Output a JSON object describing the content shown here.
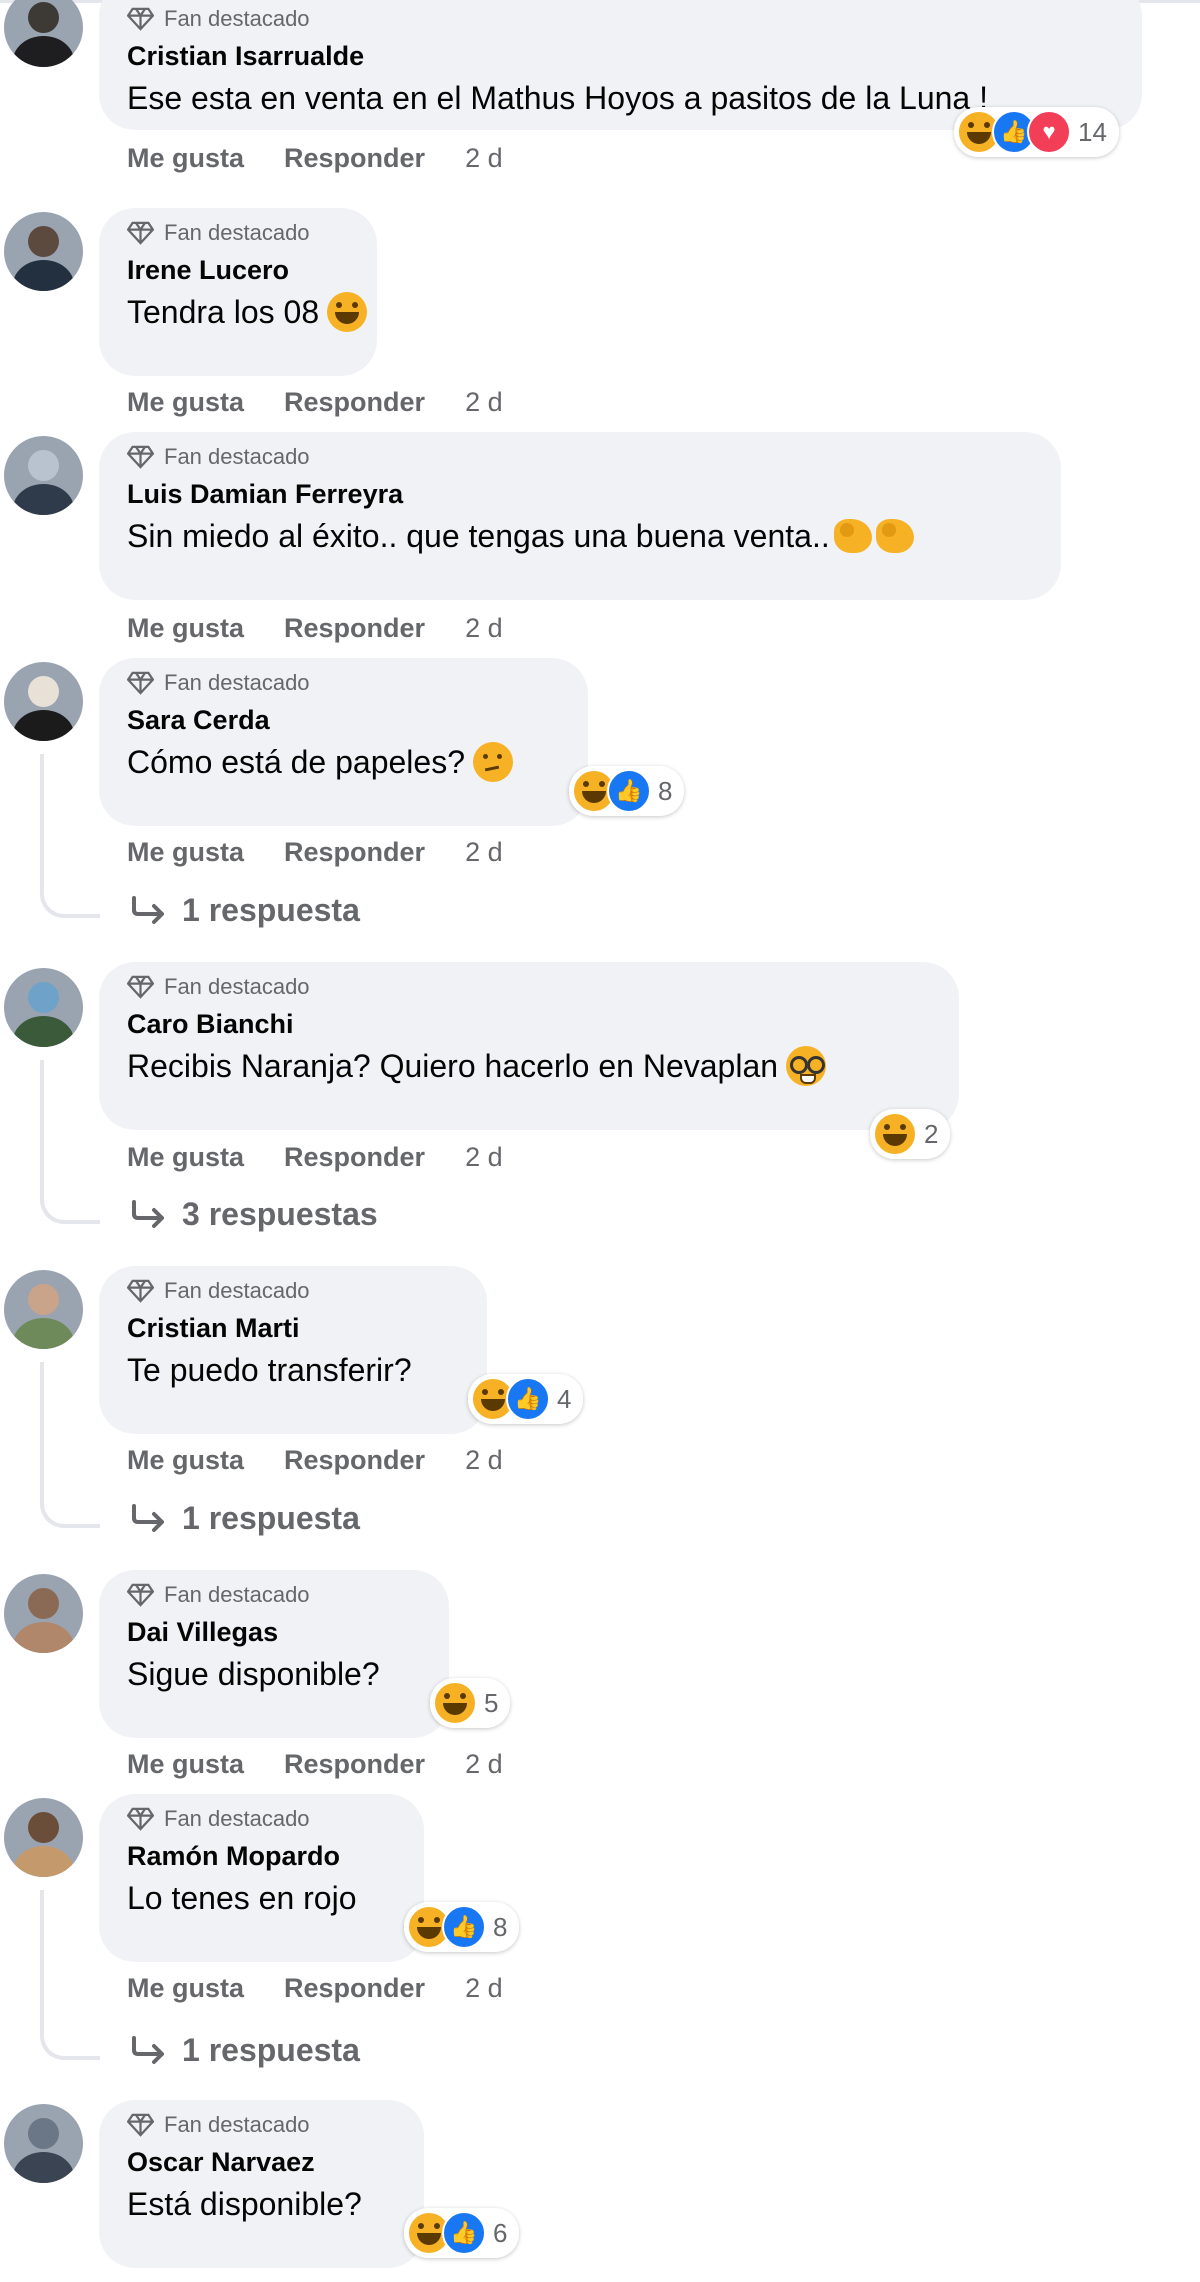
{
  "comments": [
    {
      "badge": "Fan destacado",
      "name": "Cristian Isarrualde",
      "text": "Ese esta en venta en el Mathus Hoyos a pasitos de la Luna !",
      "like": "Me gusta",
      "reply": "Responder",
      "time": "2 d",
      "reactions": {
        "icons": [
          "haha",
          "like",
          "love"
        ],
        "count": "14"
      },
      "avatar_colors": [
        "#3d3a36",
        "#1e1e20"
      ]
    },
    {
      "badge": "Fan destacado",
      "name": "Irene Lucero",
      "text": "Tendra los 08",
      "text_emoji": "haha",
      "like": "Me gusta",
      "reply": "Responder",
      "time": "2 d",
      "avatar_colors": [
        "#5d4a3f",
        "#233040"
      ]
    },
    {
      "badge": "Fan destacado",
      "name": "Luis Damian Ferreyra",
      "text": "Sin miedo al éxito.. que tengas una buena venta..",
      "text_emoji": "flexed-biceps-x2",
      "like": "Me gusta",
      "reply": "Responder",
      "time": "2 d",
      "avatar_colors": [
        "#b9c3cf",
        "#2f3b4b"
      ]
    },
    {
      "badge": "Fan destacado",
      "name": "Sara Cerda",
      "text": "Cómo está de papeles?",
      "text_emoji": "thinking",
      "like": "Me gusta",
      "reply": "Responder",
      "time": "2 d",
      "reactions": {
        "icons": [
          "haha",
          "like"
        ],
        "count": "8"
      },
      "replies": "1 respuesta",
      "avatar_colors": [
        "#e8e1d8",
        "#1b1b1b"
      ]
    },
    {
      "badge": "Fan destacado",
      "name": "Caro Bianchi",
      "text": "Recibis Naranja? Quiero hacerlo en Nevaplan",
      "text_emoji": "nerd",
      "like": "Me gusta",
      "reply": "Responder",
      "time": "2 d",
      "reactions": {
        "icons": [
          "haha"
        ],
        "count": "2"
      },
      "replies": "3 respuestas",
      "avatar_colors": [
        "#6fa2c9",
        "#3a5a3a"
      ]
    },
    {
      "badge": "Fan destacado",
      "name": "Cristian Marti",
      "text": "Te puedo transferir?",
      "like": "Me gusta",
      "reply": "Responder",
      "time": "2 d",
      "reactions": {
        "icons": [
          "haha",
          "like"
        ],
        "count": "4"
      },
      "replies": "1 respuesta",
      "avatar_colors": [
        "#c9a48a",
        "#6f8a5a"
      ]
    },
    {
      "badge": "Fan destacado",
      "name": "Dai Villegas",
      "text": "Sigue disponible?",
      "like": "Me gusta",
      "reply": "Responder",
      "time": "2 d",
      "reactions": {
        "icons": [
          "haha"
        ],
        "count": "5"
      },
      "avatar_colors": [
        "#8a6a55",
        "#b0876a"
      ]
    },
    {
      "badge": "Fan destacado",
      "name": "Ramón Mopardo",
      "text": "Lo tenes en rojo",
      "like": "Me gusta",
      "reply": "Responder",
      "time": "2 d",
      "reactions": {
        "icons": [
          "haha",
          "like"
        ],
        "count": "8"
      },
      "replies": "1 respuesta",
      "avatar_colors": [
        "#6b4e3a",
        "#c49a6c"
      ]
    },
    {
      "badge": "Fan destacado",
      "name": "Oscar Narvaez",
      "text": "Está disponible?",
      "reactions": {
        "icons": [
          "haha",
          "like"
        ],
        "count": "6"
      },
      "avatar_colors": [
        "#6b7686",
        "#3b4452"
      ]
    }
  ]
}
